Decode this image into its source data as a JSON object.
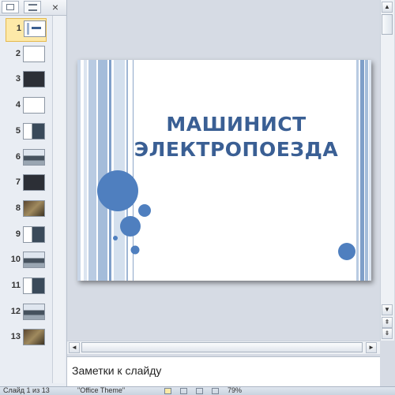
{
  "thumbnail_pane": {
    "tab_slides_icon": "slides-tab-icon",
    "tab_outline_icon": "outline-tab-icon",
    "close_label": "×",
    "slides": [
      {
        "number": "1",
        "selected": true,
        "style": "title"
      },
      {
        "number": "2",
        "selected": false,
        "style": "blank"
      },
      {
        "number": "3",
        "selected": false,
        "style": "dark"
      },
      {
        "number": "4",
        "selected": false,
        "style": "blank"
      },
      {
        "number": "5",
        "selected": false,
        "style": "mix"
      },
      {
        "number": "6",
        "selected": false,
        "style": "train"
      },
      {
        "number": "7",
        "selected": false,
        "style": "dark"
      },
      {
        "number": "8",
        "selected": false,
        "style": "photo"
      },
      {
        "number": "9",
        "selected": false,
        "style": "mix"
      },
      {
        "number": "10",
        "selected": false,
        "style": "train"
      },
      {
        "number": "11",
        "selected": false,
        "style": "mix"
      },
      {
        "number": "12",
        "selected": false,
        "style": "train"
      },
      {
        "number": "13",
        "selected": false,
        "style": "photo"
      }
    ]
  },
  "slide": {
    "title_line1": "МАШИНИСТ",
    "title_line2": "ЭЛЕКТРОПОЕЗДА",
    "accent_color": "#4f7fbf",
    "title_color": "#3a5f94"
  },
  "notes": {
    "placeholder": "Заметки к слайду"
  },
  "scrollbars": {
    "up_icon": "▲",
    "down_icon": "▼",
    "left_icon": "◄",
    "right_icon": "►",
    "prev_slide_icon": "⇞",
    "next_slide_icon": "⇟"
  },
  "status_bar": {
    "slide_info": "Слайд 1 из 13",
    "theme": "\"Office Theme\"",
    "zoom": "79%"
  }
}
